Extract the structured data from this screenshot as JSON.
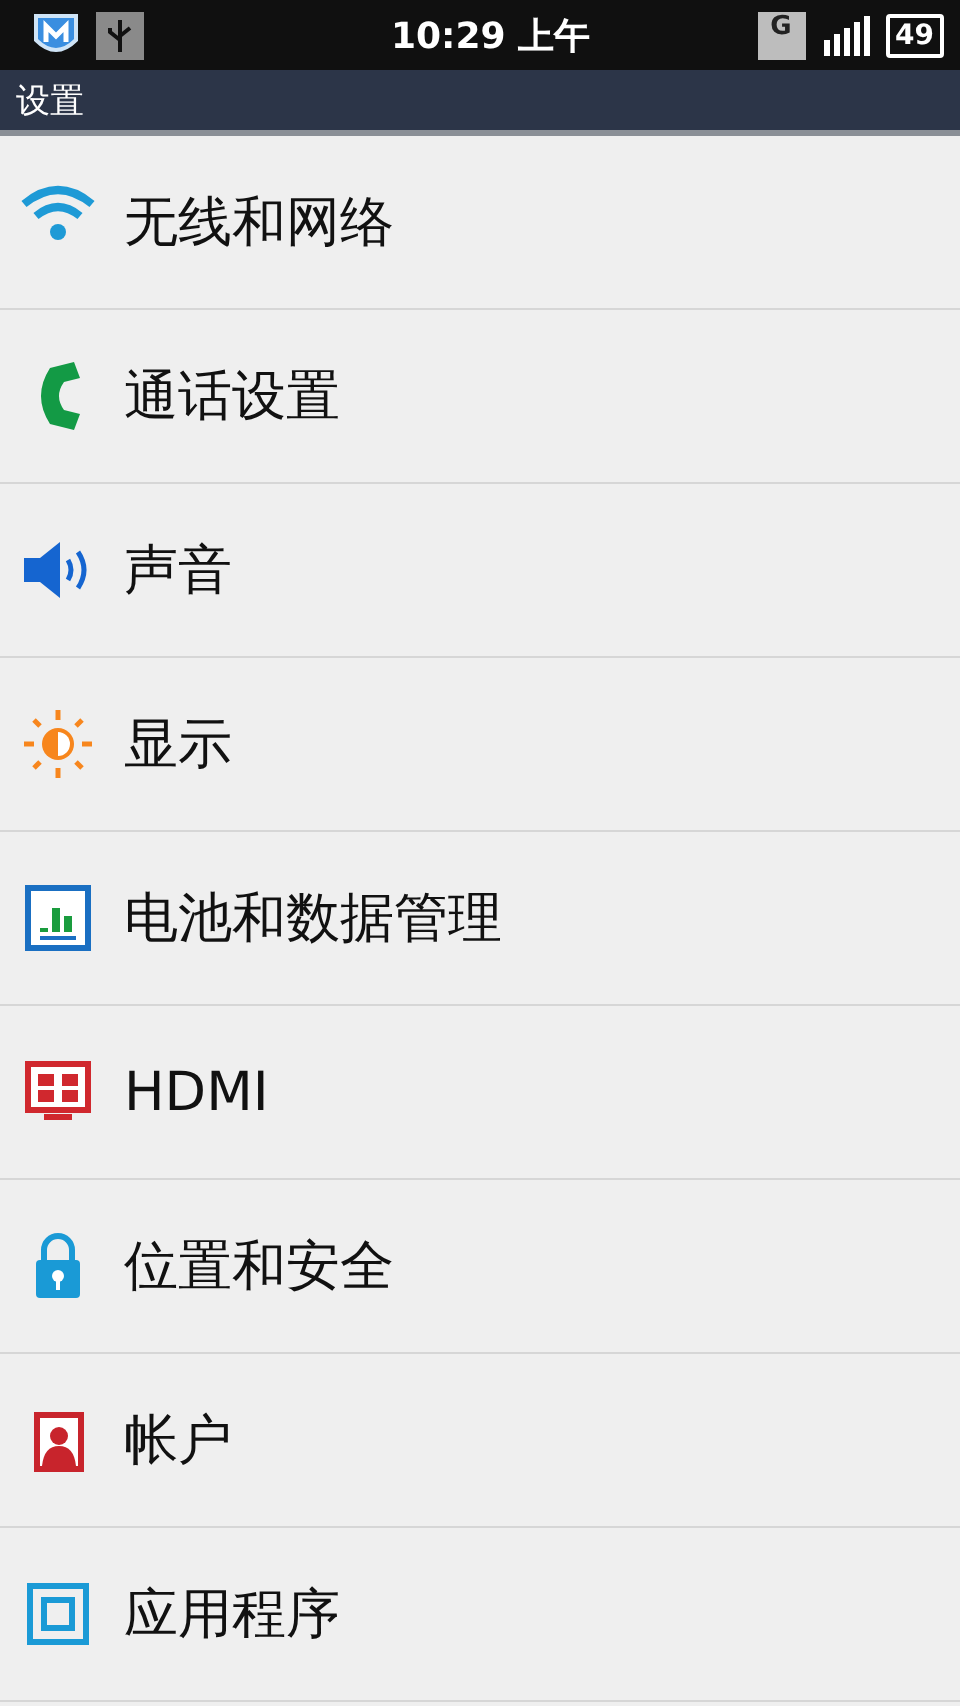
{
  "status_bar": {
    "time": "10:29 上午",
    "network_type": "G",
    "battery": "49"
  },
  "title_bar": {
    "title": "设置"
  },
  "items": [
    {
      "kind": "wifi",
      "label": "无线和网络"
    },
    {
      "kind": "phone",
      "label": "通话设置"
    },
    {
      "kind": "sound",
      "label": "声音"
    },
    {
      "kind": "display",
      "label": "显示"
    },
    {
      "kind": "battery",
      "label": "电池和数据管理"
    },
    {
      "kind": "hdmi",
      "label": "HDMI"
    },
    {
      "kind": "security",
      "label": "位置和安全"
    },
    {
      "kind": "account",
      "label": "帐户"
    },
    {
      "kind": "apps",
      "label": "应用程序"
    }
  ]
}
